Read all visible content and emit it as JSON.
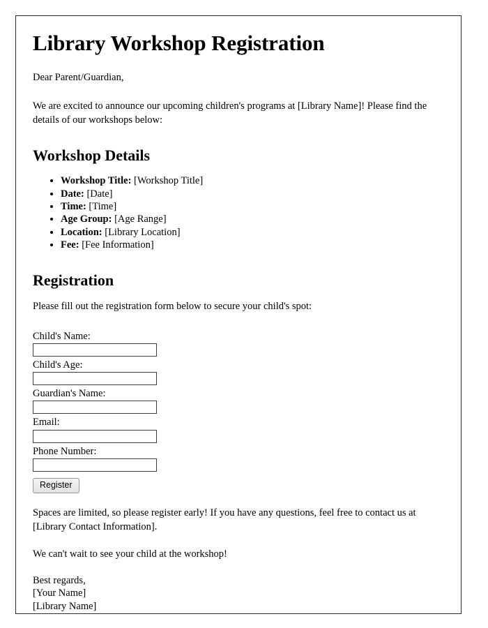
{
  "document": {
    "title": "Library Workshop Registration",
    "salutation": "Dear Parent/Guardian,",
    "intro": "We are excited to announce our upcoming children's programs at [Library Name]! Please find the details of our workshops below:",
    "sections": {
      "workshop_details": {
        "heading": "Workshop Details",
        "items": [
          {
            "key": "Workshop Title:",
            "value": "[Workshop Title]"
          },
          {
            "key": "Date:",
            "value": "[Date]"
          },
          {
            "key": "Time:",
            "value": "[Time]"
          },
          {
            "key": "Age Group:",
            "value": "[Age Range]"
          },
          {
            "key": "Location:",
            "value": "[Library Location]"
          },
          {
            "key": "Fee:",
            "value": "[Fee Information]"
          }
        ]
      },
      "registration": {
        "heading": "Registration",
        "intro": "Please fill out the registration form below to secure your child's spot:",
        "fields": [
          {
            "label": "Child's Name:",
            "value": "",
            "placeholder": ""
          },
          {
            "label": "Child's Age:",
            "value": "",
            "placeholder": ""
          },
          {
            "label": "Guardian's Name:",
            "value": "",
            "placeholder": ""
          },
          {
            "label": "Email:",
            "value": "",
            "placeholder": ""
          },
          {
            "label": "Phone Number:",
            "value": "",
            "placeholder": ""
          }
        ],
        "submit_label": "Register"
      }
    },
    "closing": {
      "paragraph_1": "Spaces are limited, so please register early! If you have any questions, feel free to contact us at [Library Contact Information].",
      "paragraph_2": "We can't wait to see your child at the workshop!"
    },
    "signature": {
      "line_1": "Best regards,",
      "line_2": "[Your Name]",
      "line_3": "[Library Name]"
    }
  },
  "colors": {
    "page_border": "#2b2b2b",
    "text": "#000000",
    "input_border": "#3c3c3c",
    "button_border": "#949494",
    "button_background": "#ededed",
    "page_background": "#ffffff"
  }
}
